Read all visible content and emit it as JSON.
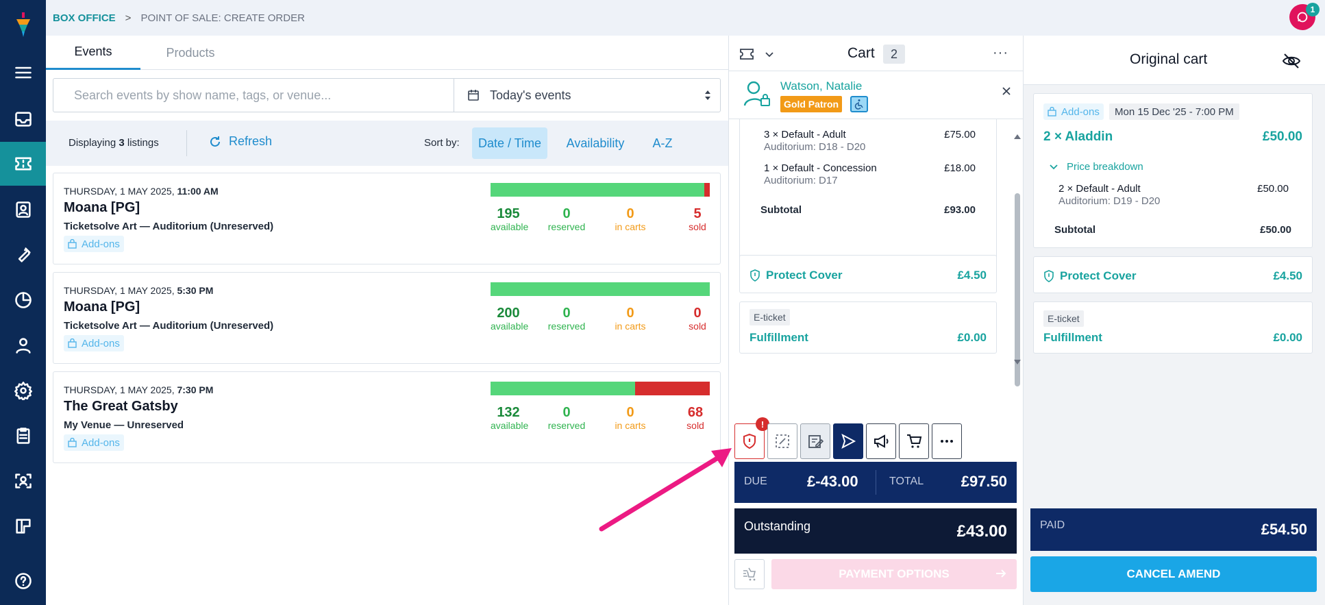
{
  "header": {
    "breadcrumb_root": "BOX OFFICE",
    "breadcrumb_separator": ">",
    "breadcrumb_current": "POINT OF SALE: CREATE ORDER",
    "notification_count": "1"
  },
  "sidebar": {
    "items": [
      {
        "icon": "menu-icon"
      },
      {
        "icon": "inbox-icon"
      },
      {
        "icon": "ticket-icon",
        "active": true
      },
      {
        "icon": "contact-card-icon"
      },
      {
        "icon": "wrench-icon"
      },
      {
        "icon": "pie-chart-icon"
      },
      {
        "icon": "person-icon"
      },
      {
        "icon": "gear-icon"
      },
      {
        "icon": "clipboard-icon"
      },
      {
        "icon": "scan-face-icon"
      },
      {
        "icon": "layout-icon"
      },
      {
        "icon": "help-icon"
      }
    ]
  },
  "events_panel": {
    "tabs": [
      {
        "label": "Events"
      },
      {
        "label": "Products"
      }
    ],
    "search_placeholder": "Search events by show name, tags, or venue...",
    "date_filter": "Today's events",
    "listing_prefix": "Displaying",
    "listing_count": "3",
    "listing_suffix": "listings",
    "refresh_label": "Refresh",
    "sort_label": "Sort by:",
    "sort_options": [
      {
        "label": "Date / Time"
      },
      {
        "label": "Availability"
      },
      {
        "label": "A-Z"
      }
    ],
    "events": [
      {
        "date": "THURSDAY, 1 MAY 2025,",
        "time": "11:00 AM",
        "title": "Moana [PG]",
        "venue": "Ticketsolve Art — Auditorium (Unreserved)",
        "addons": "Add-ons",
        "available": "195",
        "reserved": "0",
        "in_carts": "0",
        "sold": "5",
        "available_fraction": 0.975,
        "sold_fraction": 0.025
      },
      {
        "date": "THURSDAY, 1 MAY 2025,",
        "time": "5:30 PM",
        "title": "Moana [PG]",
        "venue": "Ticketsolve Art — Auditorium (Unreserved)",
        "addons": "Add-ons",
        "available": "200",
        "reserved": "0",
        "in_carts": "0",
        "sold": "0",
        "available_fraction": 1.0,
        "sold_fraction": 0.0
      },
      {
        "date": "THURSDAY, 1 MAY 2025,",
        "time": "7:30 PM",
        "title": "The Great Gatsby",
        "venue": "My Venue — Unreserved",
        "addons": "Add-ons",
        "available": "132",
        "reserved": "0",
        "in_carts": "0",
        "sold": "68",
        "available_fraction": 0.66,
        "sold_fraction": 0.34
      }
    ],
    "stat_labels": {
      "available": "available",
      "reserved": "reserved",
      "in_carts": "in carts",
      "sold": "sold"
    }
  },
  "cart": {
    "title": "Cart",
    "count": "2",
    "more": "···",
    "customer_name": "Watson, Natalie",
    "customer_badge": "Gold Patron",
    "lines": [
      {
        "label": "3 × Default - Adult",
        "seats": "Auditorium: D18 - D20",
        "price": "£75.00"
      },
      {
        "label": "1 × Default - Concession",
        "seats": "Auditorium: D17",
        "price": "£18.00"
      }
    ],
    "subtotal_label": "Subtotal",
    "subtotal": "£93.00",
    "protect_label": "Protect Cover",
    "protect_value": "£4.50",
    "eticket_label": "E-ticket",
    "fulfillment_label": "Fulfillment",
    "fulfillment_value": "£0.00",
    "alert_badge": "!",
    "due_label": "DUE",
    "due_value": "£-43.00",
    "total_label": "TOTAL",
    "total_value": "£97.50",
    "outstanding_label": "Outstanding",
    "outstanding_value": "£43.00",
    "payment_label": "PAYMENT OPTIONS"
  },
  "original_cart": {
    "title": "Original cart",
    "addons": "Add-ons",
    "date": "Mon 15 Dec '25 - 7:00 PM",
    "item_title": "2 × Aladdin",
    "item_price": "£50.00",
    "breakdown_label": "Price breakdown",
    "line_label": "2 × Default - Adult",
    "line_seats": "Auditorium: D19 - D20",
    "line_price": "£50.00",
    "subtotal_label": "Subtotal",
    "subtotal": "£50.00",
    "protect_label": "Protect Cover",
    "protect_value": "£4.50",
    "eticket_label": "E-ticket",
    "fulfillment_label": "Fulfillment",
    "fulfillment_value": "£0.00",
    "paid_label": "PAID",
    "paid_value": "£54.50",
    "cancel_label": "CANCEL AMEND"
  },
  "colors": {
    "sidebar": "#0c2a56",
    "accent_teal": "#18a39f",
    "link_blue": "#1f8ccd",
    "navy": "#0e2a66",
    "annotation_pink": "#ec1a83"
  }
}
